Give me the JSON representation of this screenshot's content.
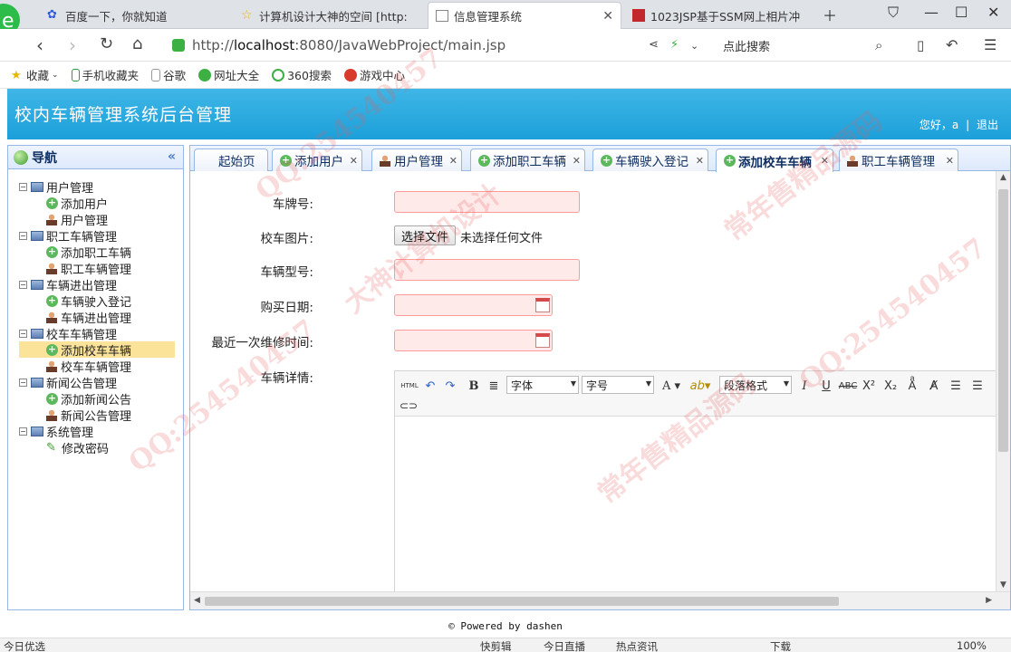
{
  "browser": {
    "tabs": [
      {
        "label": "百度一下，你就知道"
      },
      {
        "label": "计算机设计大神的空间 [http:"
      },
      {
        "label": "信息管理系统"
      },
      {
        "label": "1023JSP基于SSM网上相片冲"
      }
    ],
    "url_prefix": "http://",
    "url_host": "localhost",
    "url_path": ":8080/JavaWebProject/main.jsp",
    "search_placeholder": "点此搜索",
    "bookmarks": [
      "收藏",
      "手机收藏夹",
      "谷歌",
      "网址大全",
      "360搜索",
      "游戏中心"
    ]
  },
  "app": {
    "title": "校内车辆管理系统后台管理",
    "greeting": "您好，a",
    "logout": "退出"
  },
  "nav": {
    "title": "导航",
    "groups": [
      {
        "label": "用户管理",
        "items": [
          "添加用户",
          "用户管理"
        ]
      },
      {
        "label": "职工车辆管理",
        "items": [
          "添加职工车辆",
          "职工车辆管理"
        ]
      },
      {
        "label": "车辆进出管理",
        "items": [
          "车辆驶入登记",
          "车辆进出管理"
        ]
      },
      {
        "label": "校车车辆管理",
        "items": [
          "添加校车车辆",
          "校车车辆管理"
        ]
      },
      {
        "label": "新闻公告管理",
        "items": [
          "添加新闻公告",
          "新闻公告管理"
        ]
      },
      {
        "label": "系统管理",
        "items": [
          "修改密码"
        ]
      }
    ]
  },
  "tabs": [
    "起始页",
    "添加用户",
    "用户管理",
    "添加职工车辆",
    "车辆驶入登记",
    "添加校车车辆",
    "职工车辆管理"
  ],
  "form": {
    "plate_label": "车牌号:",
    "image_label": "校车图片:",
    "file_button": "选择文件",
    "file_status": "未选择任何文件",
    "model_label": "车辆型号:",
    "buy_date_label": "购买日期:",
    "repair_label": "最近一次维修时间:",
    "detail_label": "车辆详情:"
  },
  "editor": {
    "font_family": "字体",
    "font_size": "字号",
    "paragraph": "段落格式",
    "html_btn": "HTML"
  },
  "footer": "© Powered by dashen",
  "statusbar": [
    "今日优选",
    "快剪辑",
    "今日直播",
    "热点资讯",
    "下载",
    "100%"
  ],
  "watermarks": [
    "QQ:254540457",
    "常年售精品源码",
    "大神计算机设计"
  ]
}
